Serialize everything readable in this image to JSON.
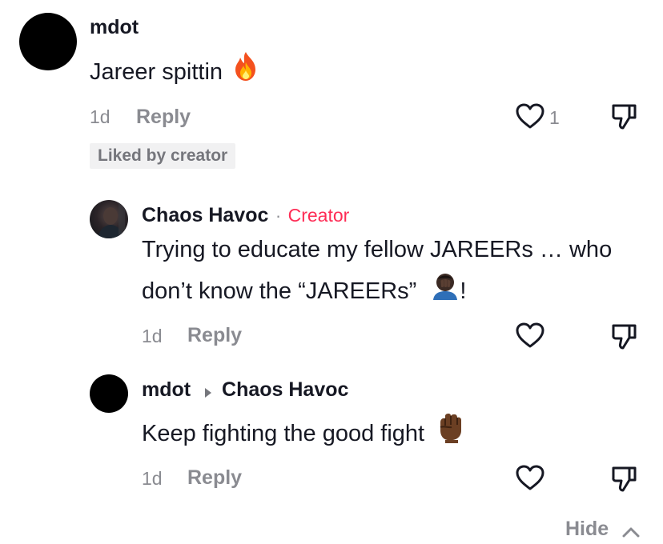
{
  "comments": [
    {
      "username": "mdot",
      "text": "Jareer spittin",
      "emoji": "fire",
      "time": "1d",
      "reply_label": "Reply",
      "like_count": "1",
      "liked_by_creator_label": "Liked by creator"
    },
    {
      "username": "Chaos Havoc",
      "separator": "·",
      "creator_label": "Creator",
      "text_line1": "Trying to educate my fellow JAREERs … who",
      "text_line2": "don’t know the “JAREERs”",
      "emoji": "facepalm",
      "text_suffix": "!",
      "time": "1d",
      "reply_label": "Reply"
    },
    {
      "username": "mdot",
      "reply_to": "Chaos Havoc",
      "text": "Keep fighting the good fight",
      "emoji": "raised-fist",
      "time": "1d",
      "reply_label": "Reply"
    }
  ],
  "footer": {
    "hide_label": "Hide"
  },
  "colors": {
    "text_primary": "#161823",
    "text_secondary": "#8a8b91",
    "creator_accent": "#fe2c55",
    "badge_bg": "#f1f1f2"
  },
  "icons": [
    "heart-outline-icon",
    "thumbs-down-icon",
    "caret-right-icon",
    "chevron-up-icon",
    "fire-emoji",
    "facepalm-emoji",
    "raised-fist-emoji"
  ]
}
